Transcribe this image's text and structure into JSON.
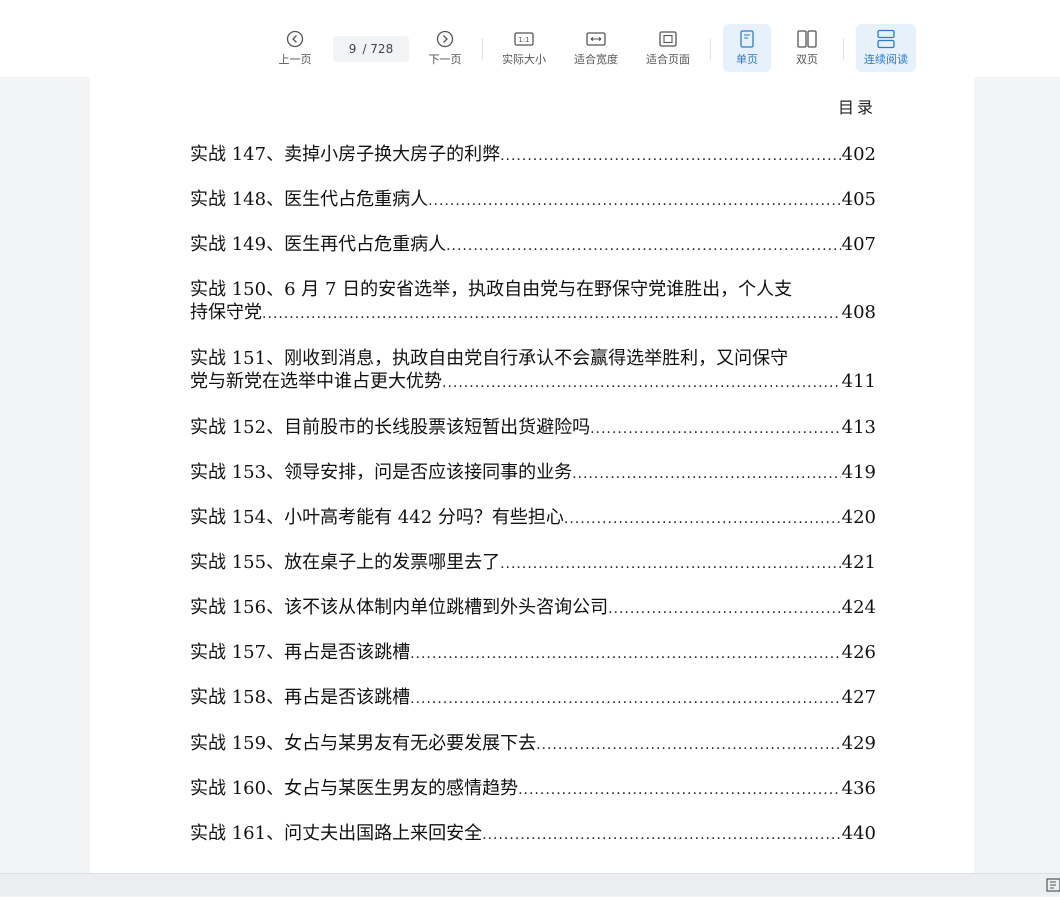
{
  "toolbar": {
    "prev_label": "上一页",
    "page_current": "9",
    "page_total": "/ 728",
    "next_label": "下一页",
    "actual_size_label": "实际大小",
    "fit_width_label": "适合宽度",
    "fit_page_label": "适合页面",
    "single_page_label": "单页",
    "double_page_label": "双页",
    "continuous_label": "连续阅读",
    "accent_color": "#2b7bd6"
  },
  "document": {
    "toc_heading": "目录",
    "entries": [
      {
        "title": "实战 147、卖掉小房子换大房子的利弊",
        "page": "402"
      },
      {
        "title": "实战 148、医生代占危重病人",
        "page": "405"
      },
      {
        "title": "实战 149、医生再代占危重病人",
        "page": "407"
      },
      {
        "line1": "实战 150、6 月 7 日的安省选举，执政自由党与在野保守党谁胜出，个人支",
        "title": "持保守党",
        "page": "408"
      },
      {
        "line1": "实战 151、刚收到消息，执政自由党自行承认不会赢得选举胜利，又问保守",
        "title": "党与新党在选举中谁占更大优势",
        "page": "411"
      },
      {
        "title": "实战 152、目前股市的长线股票该短暂出货避险吗",
        "page": "413"
      },
      {
        "title": "实战 153、领导安排，问是否应该接同事的业务",
        "page": "419"
      },
      {
        "title": "实战 154、小叶高考能有 442 分吗？有些担心",
        "page": "420"
      },
      {
        "title": "实战 155、放在桌子上的发票哪里去了 ",
        "page": "421"
      },
      {
        "title": "实战 156、该不该从体制内单位跳槽到外头咨询公司",
        "page": "424"
      },
      {
        "title": "实战 157、再占是否该跳槽 ",
        "page": "426"
      },
      {
        "title": "实战 158、再占是否该跳槽",
        "page": "427"
      },
      {
        "title": "实战 159、女占与某男友有无必要发展下去",
        "page": "429"
      },
      {
        "title": "实战 160、女占与某医生男友的感情趋势",
        "page": "436"
      },
      {
        "title": "实战 161、问丈夫出国路上来回安全",
        "page": "440"
      }
    ]
  }
}
